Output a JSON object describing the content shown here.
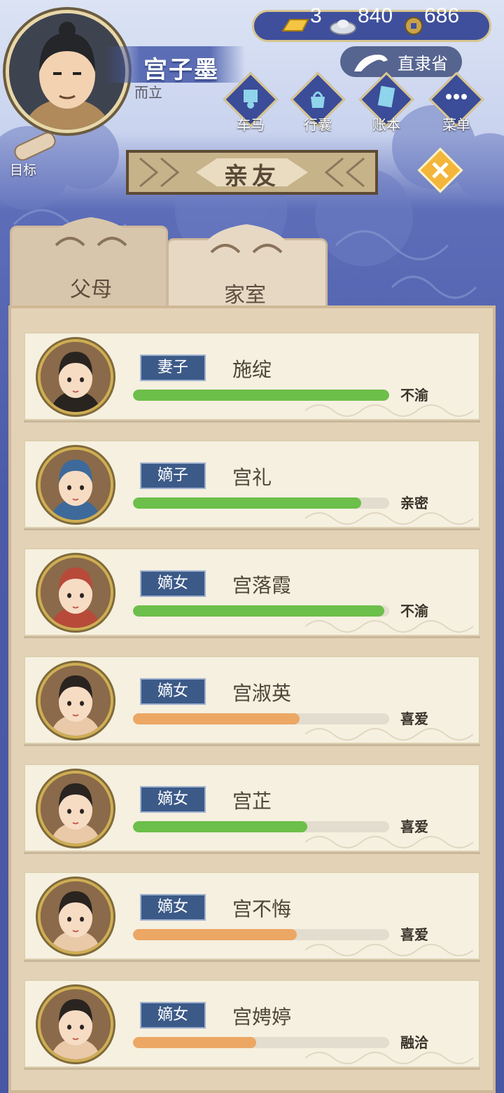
{
  "player": {
    "name": "宫子墨",
    "subtitle": "而立"
  },
  "currency": {
    "gold": "3",
    "silver": "840",
    "coin": "686"
  },
  "location": "直隶省",
  "menu": {
    "items": [
      {
        "label": "车马"
      },
      {
        "label": "行囊"
      },
      {
        "label": "账本"
      },
      {
        "label": "菜单"
      }
    ]
  },
  "goal_label": "目标",
  "title": "亲友",
  "tabs": [
    {
      "label": "父母"
    },
    {
      "label": "家室"
    }
  ],
  "active_tab": "家室",
  "colors": {
    "green": "#6cbf4a",
    "orange": "#eca765",
    "role_bg": "#3c5a88"
  },
  "members": [
    {
      "role": "妻子",
      "name": "施绽",
      "relation": "不渝",
      "bar": 1.0,
      "bar_color": "green",
      "avatar": "wife-portrait-icon"
    },
    {
      "role": "嫡子",
      "name": "宫礼",
      "relation": "亲密",
      "bar": 0.89,
      "bar_color": "green",
      "avatar": "baby-boy-portrait-icon"
    },
    {
      "role": "嫡女",
      "name": "宫落霞",
      "relation": "不渝",
      "bar": 0.98,
      "bar_color": "green",
      "avatar": "baby-girl-portrait-icon"
    },
    {
      "role": "嫡女",
      "name": "宫淑英",
      "relation": "喜爱",
      "bar": 0.65,
      "bar_color": "orange",
      "avatar": "girl-portrait-icon"
    },
    {
      "role": "嫡女",
      "name": "宫芷",
      "relation": "喜爱",
      "bar": 0.68,
      "bar_color": "green",
      "avatar": "girl-portrait-icon"
    },
    {
      "role": "嫡女",
      "name": "宫不悔",
      "relation": "喜爱",
      "bar": 0.64,
      "bar_color": "orange",
      "avatar": "girl-portrait-icon"
    },
    {
      "role": "嫡女",
      "name": "宫娉婷",
      "relation": "融洽",
      "bar": 0.48,
      "bar_color": "orange",
      "avatar": "girl-portrait-icon"
    }
  ]
}
